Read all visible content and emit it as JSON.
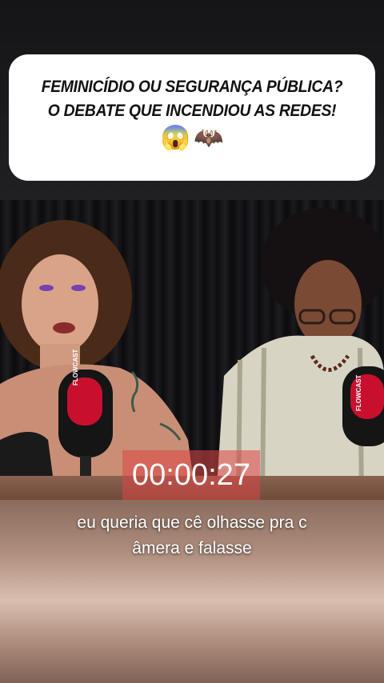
{
  "caption": {
    "line1": "FEMINICÍDIO OU SEGURANÇA PÚBLICA?",
    "line2": "O DEBATE QUE INCENDIOU AS REDES!",
    "emojis": [
      "😱",
      "🦇"
    ]
  },
  "video": {
    "timer": "00:00:27",
    "subtitle_line1": "eu queria que cê olhasse pra c",
    "subtitle_line2": "âmera e falasse",
    "mic_labels": [
      "FLOWCAST",
      "FLOWCAST"
    ]
  },
  "colors": {
    "caption_bg": "#ffffff",
    "timer_bg": "#dc4646",
    "mic_red": "#c8102e"
  }
}
